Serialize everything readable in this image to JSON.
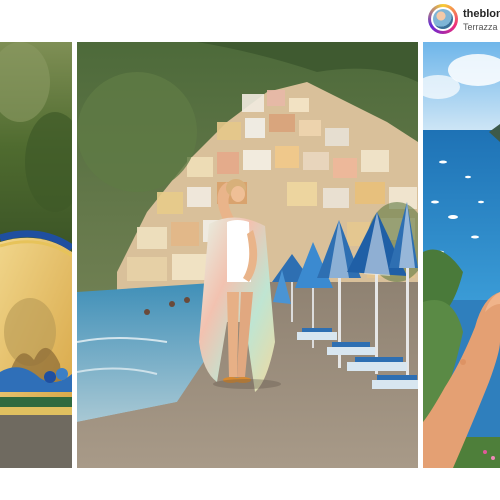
{
  "post": {
    "username": "theblon",
    "location": "Terrazza"
  },
  "images": {
    "left": "majolica-tile-bench-photo",
    "center": "woman-on-positano-beach-photo",
    "right": "sea-with-boats-photo"
  },
  "colors": {
    "sea": "#2f7fbd",
    "umbrella_blue": "#2e6fb2",
    "tile_yellow": "#e2b84a",
    "sand": "#8e7f6d"
  }
}
